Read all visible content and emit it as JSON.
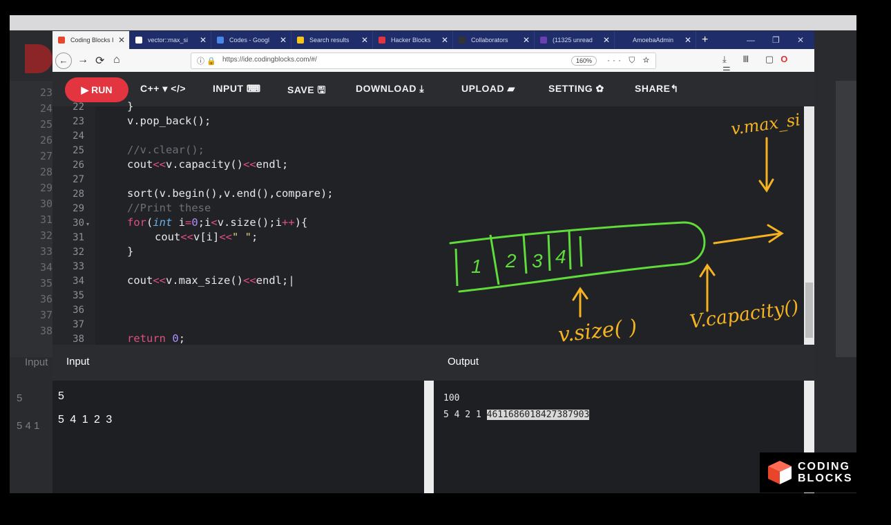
{
  "ghost": {
    "line_numbers": [
      "23",
      "24",
      "25",
      "26",
      "27",
      "28",
      "29",
      "30",
      "31",
      "32",
      "33",
      "34",
      "35",
      "36",
      "37",
      "38"
    ],
    "input_label": "Input",
    "input_lines": [
      "5",
      "5 4 1"
    ]
  },
  "browser": {
    "tabs": [
      {
        "title": "Coding Blocks I",
        "icon_color": "#e8452b"
      },
      {
        "title": "vector::max_si",
        "icon_color": "#ffffff"
      },
      {
        "title": "Codes - Googl",
        "icon_color": "#4a86e8"
      },
      {
        "title": "Search results",
        "icon_color": "#f5c518"
      },
      {
        "title": "Hacker Blocks",
        "icon_color": "#e23540"
      },
      {
        "title": "Collaborators",
        "icon_color": "#333333"
      },
      {
        "title": "(11325 unread",
        "icon_color": "#6a3fb0"
      },
      {
        "title": "AmoebaAdmin",
        "icon_color": "#1f2d6b"
      }
    ],
    "url": "https://ide.codingblocks.com/#/",
    "zoom": "160%",
    "url_icons": "··· ⛉ ☆",
    "right_icons": "⤓ Ⅲ ▢"
  },
  "toolbar": {
    "run": "▶ RUN",
    "lang": "C++ ▾ </>",
    "input": "INPUT ⌨",
    "save": "SAVE 🖫",
    "download": "DOWNLOAD ⤓",
    "upload": "UPLOAD ▰",
    "setting": "SETTING ✿",
    "share": "SHARE↰"
  },
  "editor": {
    "line_numbers": [
      "22",
      "23",
      "24",
      "25",
      "26",
      "27",
      "28",
      "29",
      "30",
      "31",
      "32",
      "33",
      "34",
      "35",
      "36",
      "37",
      "38"
    ]
  },
  "io": {
    "input_label": "Input",
    "output_label": "Output",
    "input_lines": [
      "5",
      "5 4 1 2 3"
    ],
    "output_line1": "100",
    "output_line2_plain": "5 4 2 1 ",
    "output_line2_selected": "4611686018427387903"
  },
  "annotations": {
    "boxes": [
      "1",
      "2",
      "3",
      "4"
    ],
    "max_size_label": "v.max_si",
    "size_label": "v.size( )",
    "capacity_label": "V.capacity()"
  },
  "logo": {
    "line1": "CODING",
    "line2": "BLOCKS"
  },
  "colors": {
    "run": "#e23540",
    "tabbar": "#1f2d6b",
    "keyword": "#e0507d",
    "number": "#b58bff",
    "annotation_green": "#5fdc3c",
    "annotation_orange": "#f5b321"
  }
}
